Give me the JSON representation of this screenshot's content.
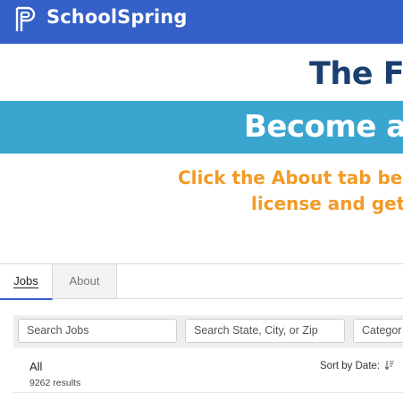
{
  "header": {
    "brand": "SchoolSpring"
  },
  "banner": {
    "headline_partial": "The Fu",
    "subheadline_partial": "Become a",
    "promo_line1": "Click the About tab belo",
    "promo_line2": "license and get s"
  },
  "tabs": [
    {
      "label": "Jobs",
      "active": true
    },
    {
      "label": "About",
      "active": false
    }
  ],
  "filters": {
    "search_jobs_placeholder": "Search Jobs",
    "location_placeholder": "Search State, City, or Zip",
    "category_placeholder": "Categor"
  },
  "results": {
    "group_label": "All",
    "count_text": "9262 results",
    "sort_label": "Sort by Date:"
  },
  "colors": {
    "header_bg": "#3460c7",
    "banner_navy": "#1b3f6e",
    "banner_blue": "#3aa6cf",
    "promo_orange": "#f29b26"
  }
}
